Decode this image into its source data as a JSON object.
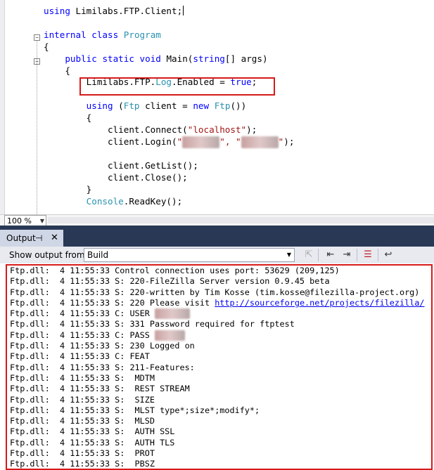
{
  "editor": {
    "line_using_lib": "Limilabs.FTP.Client;",
    "kw_using": "using",
    "kw_internal": "internal",
    "kw_class": "class",
    "class_name": "Program",
    "kw_public": "public",
    "kw_static": "static",
    "kw_void": "void",
    "main_sig_a": "Main(",
    "kw_string": "string",
    "main_sig_b": "[] args)",
    "log_a": "Limilabs.FTP.",
    "log_type": "Log",
    "log_b": ".Enabled = ",
    "kw_true": "true",
    "log_c": ";",
    "using2_kw": "using",
    "using2_a": " (",
    "ftp_type": "Ftp",
    "using2_b": " client = ",
    "kw_new": "new",
    "using2_c": " ",
    "ftp_type2": "Ftp",
    "using2_d": "())",
    "connect_a": "client.Connect(",
    "connect_str": "\"localhost\"",
    "connect_b": ");",
    "login_a": "client.Login(",
    "login_q1": "\"",
    "login_q2": "\", \"",
    "login_q3": "\"",
    "login_b": ");",
    "getlist": "client.GetList();",
    "close": "client.Close();",
    "console_type": "Console",
    "readkey": ".ReadKey();",
    "zoom": "100 %"
  },
  "output": {
    "tab_label": "Output",
    "pin_icon": "pin-icon",
    "close_icon": "close-icon",
    "show_label": "Show output from:",
    "source_selected": "Build",
    "lines": [
      "Ftp.dll:  4 11:55:33 Control connection uses port: 53629 (209,125)",
      "Ftp.dll:  4 11:55:33 S: 220-FileZilla Server version 0.9.45 beta",
      "Ftp.dll:  4 11:55:33 S: 220-written by Tim Kosse (tim.kosse@filezilla-project.org)",
      "Ftp.dll:  4 11:55:33 S: 220 Please visit ",
      "Ftp.dll:  4 11:55:33 C: USER ",
      "Ftp.dll:  4 11:55:33 S: 331 Password required for ftptest",
      "Ftp.dll:  4 11:55:33 C: PASS ",
      "Ftp.dll:  4 11:55:33 S: 230 Logged on",
      "Ftp.dll:  4 11:55:33 C: FEAT",
      "Ftp.dll:  4 11:55:33 S: 211-Features:",
      "Ftp.dll:  4 11:55:33 S:  MDTM",
      "Ftp.dll:  4 11:55:33 S:  REST STREAM",
      "Ftp.dll:  4 11:55:33 S:  SIZE",
      "Ftp.dll:  4 11:55:33 S:  MLST type*;size*;modify*;",
      "Ftp.dll:  4 11:55:33 S:  MLSD",
      "Ftp.dll:  4 11:55:33 S:  AUTH SSL",
      "Ftp.dll:  4 11:55:33 S:  AUTH TLS",
      "Ftp.dll:  4 11:55:33 S:  PROT",
      "Ftp.dll:  4 11:55:33 S:  PBSZ"
    ],
    "link": "http://sourceforge.net/projects/filezilla/"
  }
}
